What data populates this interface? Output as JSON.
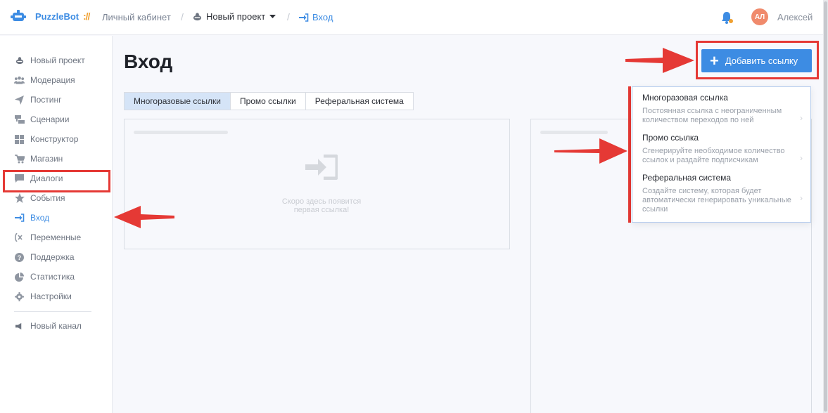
{
  "header": {
    "brand": "PuzzleBot",
    "brand_sep": "://",
    "breadcrumb_cabinet": "Личный кабинет",
    "breadcrumb_project": "Новый проект",
    "breadcrumb_current": "Вход",
    "avatar_initials": "АЛ",
    "username": "Алексей"
  },
  "sidebar": {
    "items": [
      {
        "label": "Новый проект",
        "icon": "bot-icon"
      },
      {
        "label": "Модерация",
        "icon": "users-icon"
      },
      {
        "label": "Постинг",
        "icon": "send-icon"
      },
      {
        "label": "Сценарии",
        "icon": "scenario-icon"
      },
      {
        "label": "Конструктор",
        "icon": "grid-icon"
      },
      {
        "label": "Магазин",
        "icon": "cart-icon"
      },
      {
        "label": "Диалоги",
        "icon": "chat-icon"
      },
      {
        "label": "События",
        "icon": "star-icon"
      },
      {
        "label": "Вход",
        "icon": "sign-in-icon",
        "active": true
      },
      {
        "label": "Переменные",
        "icon": "variable-icon"
      },
      {
        "label": "Поддержка",
        "icon": "help-icon"
      },
      {
        "label": "Статистика",
        "icon": "pie-chart-icon"
      },
      {
        "label": "Настройки",
        "icon": "gear-icon"
      }
    ],
    "channel": {
      "label": "Новый канал",
      "icon": "channel-icon"
    }
  },
  "main": {
    "title": "Вход",
    "tabs": [
      {
        "label": "Многоразовые ссылки",
        "active": true
      },
      {
        "label": "Промо ссылки"
      },
      {
        "label": "Реферальная система"
      }
    ],
    "empty_text_line1": "Скоро здесь появится",
    "empty_text_line2": "первая ссылка!"
  },
  "add_button": {
    "label": "Добавить ссылку"
  },
  "dropdown": {
    "items": [
      {
        "title": "Многоразовая ссылка",
        "desc": "Постоянная ссылка с неограниченным количеством переходов по ней"
      },
      {
        "title": "Промо ссылка",
        "desc": "Сгенерируйте необходимое количество ссылок и раздайте подписчикам"
      },
      {
        "title": "Реферальная система",
        "desc": "Создайте систему, которая будет автоматически генерировать уникальные ссылки"
      }
    ]
  },
  "colors": {
    "accent": "#3d8ce3",
    "annotation": "#e53935",
    "brand_sep": "#f0a030"
  }
}
